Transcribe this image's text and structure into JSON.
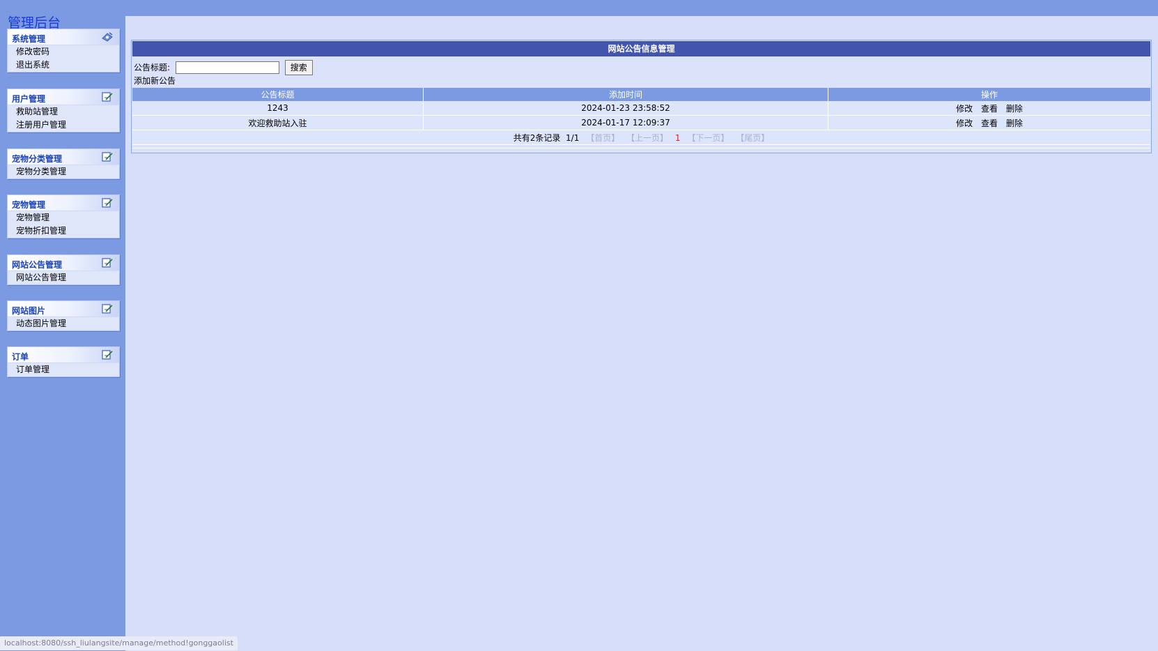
{
  "sidebar": {
    "title": "管理后台",
    "groups": [
      {
        "label": "系统管理",
        "icon": "system-settings-icon",
        "items": [
          "修改密码",
          "退出系统"
        ]
      },
      {
        "label": "用户管理",
        "icon": "edit-icon",
        "items": [
          "救助站管理",
          "注册用户管理"
        ]
      },
      {
        "label": "宠物分类管理",
        "icon": "edit-icon",
        "items": [
          "宠物分类管理"
        ]
      },
      {
        "label": "宠物管理",
        "icon": "edit-icon",
        "items": [
          "宠物管理",
          "宠物折扣管理"
        ]
      },
      {
        "label": "网站公告管理",
        "icon": "edit-icon",
        "items": [
          "网站公告管理"
        ]
      },
      {
        "label": "网站图片",
        "icon": "edit-icon",
        "items": [
          "动态图片管理"
        ]
      },
      {
        "label": "订单",
        "icon": "edit-icon",
        "items": [
          "订单管理"
        ]
      }
    ]
  },
  "panel": {
    "title": "网站公告信息管理",
    "search_label": "公告标题:",
    "search_value": "",
    "search_button": "搜索",
    "add_link": "添加新公告"
  },
  "table": {
    "headers": [
      "公告标题",
      "添加时间",
      "操作"
    ],
    "rows": [
      {
        "title": "1243",
        "time": "2024-01-23 23:58:52"
      },
      {
        "title": "欢迎救助站入驻",
        "time": "2024-01-17 12:09:37"
      }
    ],
    "actions": [
      "修改",
      "查看",
      "删除"
    ]
  },
  "pager": {
    "summary": "共有2条记录  1/1",
    "first": "【首页】",
    "prev": "【上一页】",
    "current": "1",
    "next": "【下一页】",
    "last": "【尾页】"
  },
  "status_url": "localhost:8080/ssh_liulangsite/manage/method!gonggaolist",
  "colors": {
    "sidebar_bg": "#7b9ae2",
    "main_bg": "#d6defa",
    "title_bar": "#4254ad",
    "header_row": "#7b9ae2",
    "current_page": "#e01e1e"
  }
}
